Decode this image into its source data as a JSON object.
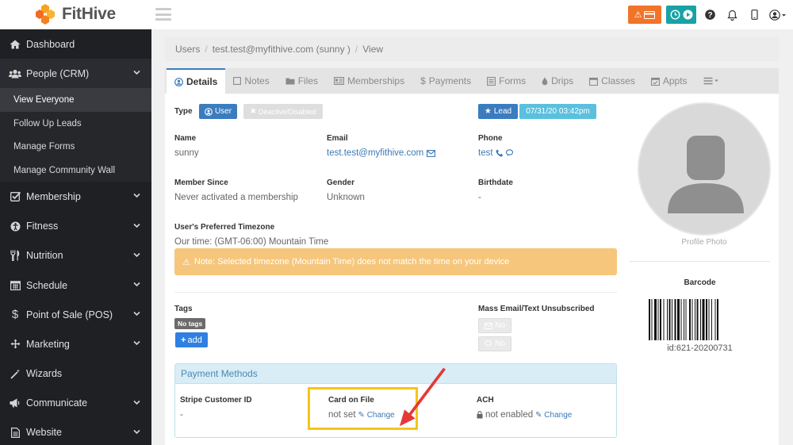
{
  "brand": {
    "name": "FitHive"
  },
  "sidebar": {
    "items": [
      {
        "label": "Dashboard",
        "icon": "home-icon"
      },
      {
        "label": "People (CRM)",
        "icon": "users-icon",
        "open": true,
        "children": [
          "View Everyone",
          "Follow Up Leads",
          "Manage Forms",
          "Manage Community Wall"
        ]
      },
      {
        "label": "Membership",
        "icon": "check-square-icon"
      },
      {
        "label": "Fitness",
        "icon": "fitness-icon"
      },
      {
        "label": "Nutrition",
        "icon": "utensils-icon"
      },
      {
        "label": "Schedule",
        "icon": "calendar-icon"
      },
      {
        "label": "Point of Sale (POS)",
        "icon": "dollar-icon"
      },
      {
        "label": "Marketing",
        "icon": "arrows-icon"
      },
      {
        "label": "Wizards",
        "icon": "magic-wand-icon"
      },
      {
        "label": "Communicate",
        "icon": "bullhorn-icon"
      },
      {
        "label": "Website",
        "icon": "page-icon"
      }
    ]
  },
  "breadcrumb": [
    "Users",
    "test.test@myfithive.com (sunny )",
    "View"
  ],
  "tabs": [
    {
      "label": "Details",
      "icon": "user-circle-icon",
      "active": true
    },
    {
      "label": "Notes",
      "icon": "note-icon"
    },
    {
      "label": "Files",
      "icon": "folder-icon"
    },
    {
      "label": "Memberships",
      "icon": "id-card-icon"
    },
    {
      "label": "Payments",
      "icon": "dollar-icon"
    },
    {
      "label": "Forms",
      "icon": "forms-icon"
    },
    {
      "label": "Drips",
      "icon": "drop-icon"
    },
    {
      "label": "Classes",
      "icon": "calendar-icon"
    },
    {
      "label": "Appts",
      "icon": "calendar-check-icon"
    },
    {
      "label": "",
      "icon": "menu-icon"
    }
  ],
  "details": {
    "type_label": "Type",
    "type_user": "User",
    "type_deactive": "Deactive/Disabled",
    "lead_badge": "Lead",
    "date_badge": "07/31/20 03:42pm",
    "name_label": "Name",
    "name_value": "sunny",
    "email_label": "Email",
    "email_value": "test.test@myfithive.com",
    "phone_label": "Phone",
    "phone_value": "test",
    "member_since_label": "Member Since",
    "member_since_value": "Never activated a membership",
    "gender_label": "Gender",
    "gender_value": "Unknown",
    "birthdate_label": "Birthdate",
    "birthdate_value": "-",
    "tz_label": "User's Preferred Timezone",
    "tz_value": "Our time: (GMT-06:00) Mountain Time",
    "tz_alert": "Note: Selected timezone (Mountain Time) does not match the time on your device",
    "tags_label": "Tags",
    "no_tags": "No tags",
    "add_label": "add",
    "unsub_label": "Mass Email/Text Unsubscribed",
    "no_label": "No"
  },
  "profile": {
    "caption": "Profile Photo",
    "barcode_title": "Barcode",
    "barcode_id": "id:621-20200731"
  },
  "payment": {
    "title": "Payment Methods",
    "stripe_label": "Stripe Customer ID",
    "stripe_value": "-",
    "card_label": "Card on File",
    "card_value": "not set",
    "ach_label": "ACH",
    "ach_value": "not enabled",
    "change_label": "Change"
  },
  "colors": {
    "accent": "#3b7cbf",
    "orange": "#f0742a",
    "teal": "#17a2a6",
    "highlight": "#f5c518",
    "arrow": "#e53935"
  }
}
